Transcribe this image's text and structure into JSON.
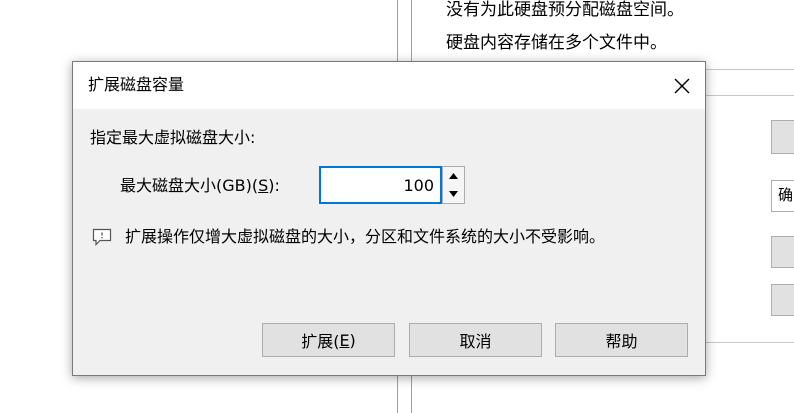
{
  "background_window": {
    "line1": "没有为此硬盘预分配磁盘空间。",
    "line2": "硬盘内容存储在多个文件中。",
    "partial_button_label": "确"
  },
  "dialog": {
    "title": "扩展磁盘容量",
    "section_label": "指定最大虚拟磁盘大小:",
    "size_label_prefix": "最大磁盘大小(GB)(",
    "size_label_accel": "S",
    "size_label_suffix": "):",
    "size_value": "100",
    "info_text": "扩展操作仅增大虚拟磁盘的大小，分区和文件系统的大小不受影响。",
    "buttons": {
      "expand_prefix": "扩展(",
      "expand_accel": "E",
      "expand_suffix": ")",
      "cancel": "取消",
      "help": "帮助"
    }
  },
  "icons": {
    "close": "close-icon",
    "spin_up": "chevron-up-icon",
    "spin_down": "chevron-down-icon",
    "info": "speech-bubble-icon"
  },
  "colors": {
    "dialog_bg": "#f0f0f0",
    "titlebar_bg": "#ffffff",
    "focus_border": "#0078d7",
    "button_bg": "#e1e1e1",
    "button_border": "#adadad"
  }
}
